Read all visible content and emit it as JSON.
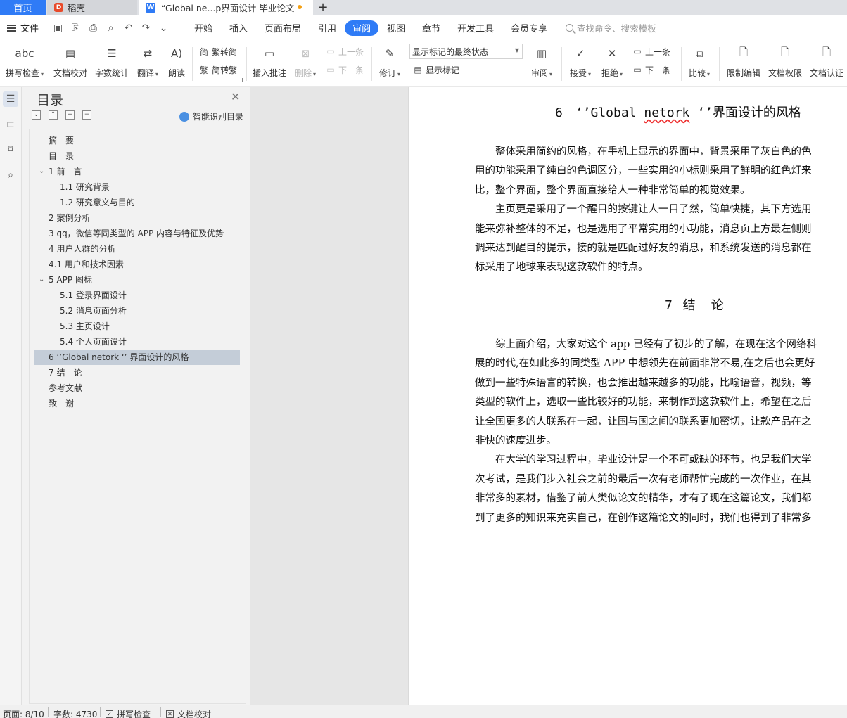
{
  "tabs": {
    "home": "首页",
    "daoke": "稻壳",
    "doc": "“Global ne...p界面设计 毕业论文"
  },
  "menu": {
    "file": "文件",
    "items": [
      "开始",
      "插入",
      "页面布局",
      "引用",
      "审阅",
      "视图",
      "章节",
      "开发工具",
      "会员专享"
    ],
    "active_index": 4,
    "search_placeholder": "查找命令、搜索模板"
  },
  "ribbon": {
    "spell_check": "拼写检查",
    "doc_proof": "文档校对",
    "word_count": "字数统计",
    "translate": "翻译",
    "read_aloud": "朗读",
    "trad_to_simp": "繁转简",
    "simp_to_trad": "简转繁",
    "insert_comment": "插入批注",
    "delete": "删除",
    "prev_comment": "上一条",
    "next_comment": "下一条",
    "track_changes": "修订",
    "markup_mode": "显示标记的最终状态",
    "show_markup": "显示标记",
    "review_pane": "审阅",
    "accept": "接受",
    "reject": "拒绝",
    "prev_change": "上一条",
    "next_change": "下一条",
    "compare": "比较",
    "restrict_edit": "限制编辑",
    "doc_permission": "文档权限",
    "doc_certify": "文档认证"
  },
  "toc": {
    "title": "目录",
    "smart_detect": "智能识别目录",
    "items": [
      {
        "text": "摘　要",
        "level": 1
      },
      {
        "text": "目　录",
        "level": 1
      },
      {
        "text": "1 前　言",
        "level": 1,
        "expanded": true
      },
      {
        "text": "1.1 研究背景",
        "level": 2
      },
      {
        "text": "1.2 研究意义与目的",
        "level": 2
      },
      {
        "text": "2 案例分析",
        "level": 1
      },
      {
        "text": "3 qq，微信等同类型的 APP 内容与特征及优势",
        "level": 1
      },
      {
        "text": "4 用户人群的分析",
        "level": 1
      },
      {
        "text": "4.1 用户和技术因素",
        "level": 1
      },
      {
        "text": "5 APP 图标",
        "level": 1,
        "expanded": true
      },
      {
        "text": "5.1 登录界面设计",
        "level": 2
      },
      {
        "text": "5.2 消息页面分析",
        "level": 2
      },
      {
        "text": "5.3 主页设计",
        "level": 2
      },
      {
        "text": "5.4 个人页面设计",
        "level": 2
      },
      {
        "text": "6 ‘’Global netork ‘’ 界面设计的风格",
        "level": 1,
        "selected": true
      },
      {
        "text": "7 结　论",
        "level": 1
      },
      {
        "text": "参考文献",
        "level": 1
      },
      {
        "text": "致　谢",
        "level": 1
      }
    ]
  },
  "document": {
    "heading6_prefix": "6　‘’Global ",
    "heading6_misspelled": "netork",
    "heading6_suffix": " ‘’界面设计的风格",
    "heading7": "7 结　论",
    "section6_lines": [
      "　　整体采用简约的风格，在手机上显示的界面中，背景采用了灰白色的色",
      "用的功能采用了纯白的色调区分，一些实用的小标则采用了鲜明的红色灯来",
      "比，整个界面，整个界面直接给人一种非常简单的视觉效果。",
      "　　主页更是采用了一个醒目的按键让人一目了然，简单快捷，其下方选用",
      "能来弥补整体的不足，也是选用了平常实用的小功能，消息页上方最左侧则",
      "调来达到醒目的提示，接的就是匹配过好友的消息，和系统发送的消息都在",
      "标采用了地球来表现这款软件的特点。"
    ],
    "section7_lines": [
      "　　综上面介绍，大家对这个 app 已经有了初步的了解，在现在这个网络科",
      "展的时代,在如此多的同类型 APP 中想领先在前面非常不易,在之后也会更好",
      "做到一些特殊语言的转换，也会推出越来越多的功能，比喻语音，视频，等",
      "类型的软件上，选取一些比较好的功能，来制作到这款软件上，希望在之后",
      "让全国更多的人联系在一起，让国与国之间的联系更加密切，让款产品在之",
      "非快的速度进步。",
      "　　在大学的学习过程中，毕业设计是一个不可或缺的环节，也是我们大学",
      "次考试，是我们步入社会之前的最后一次有老师帮忙完成的一次作业，在其",
      "非常多的素材，借鉴了前人类似论文的精华，才有了现在这篇论文，我们都",
      "到了更多的知识来充实自己，在创作这篇论文的同时，我们也得到了非常多"
    ]
  },
  "status": {
    "page": "页面: 8/10",
    "words": "字数: 4730",
    "spell_check": "拼写检查",
    "doc_proof": "文档校对"
  }
}
